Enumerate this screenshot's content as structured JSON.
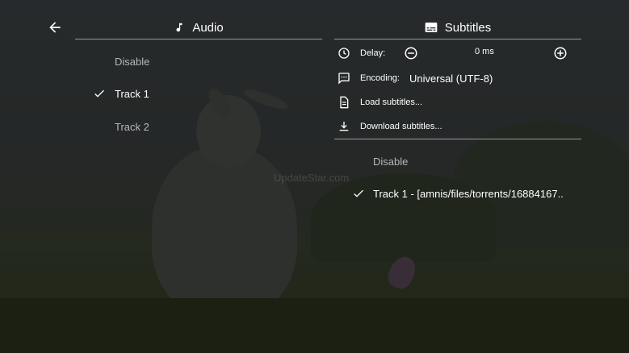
{
  "watermark": "UpdateStar.com",
  "audio": {
    "title": "Audio",
    "tracks": [
      {
        "label": "Disable",
        "selected": false
      },
      {
        "label": "Track 1",
        "selected": true
      },
      {
        "label": "Track 2",
        "selected": false
      }
    ]
  },
  "subtitles": {
    "title": "Subtitles",
    "delay": {
      "label": "Delay:",
      "value": "0 ms"
    },
    "encoding": {
      "label": "Encoding:",
      "value": "Universal (UTF-8)"
    },
    "load_label": "Load subtitles...",
    "download_label": "Download subtitles...",
    "tracks": [
      {
        "label": "Disable",
        "selected": false
      },
      {
        "label": "Track 1 - [amnis/files/torrents/16884167..",
        "selected": true
      }
    ]
  },
  "icons": {
    "back": "arrow-left-icon",
    "audio": "music-note-icon",
    "subtitles": "subtitles-icon",
    "delay": "clock-icon",
    "encoding": "message-text-icon",
    "load": "file-document-icon",
    "download": "download-icon",
    "check": "check-icon"
  },
  "colors": {
    "text": "#ffffff",
    "dim_text": "#b7b7b7",
    "divider": "#9a9a9a"
  }
}
